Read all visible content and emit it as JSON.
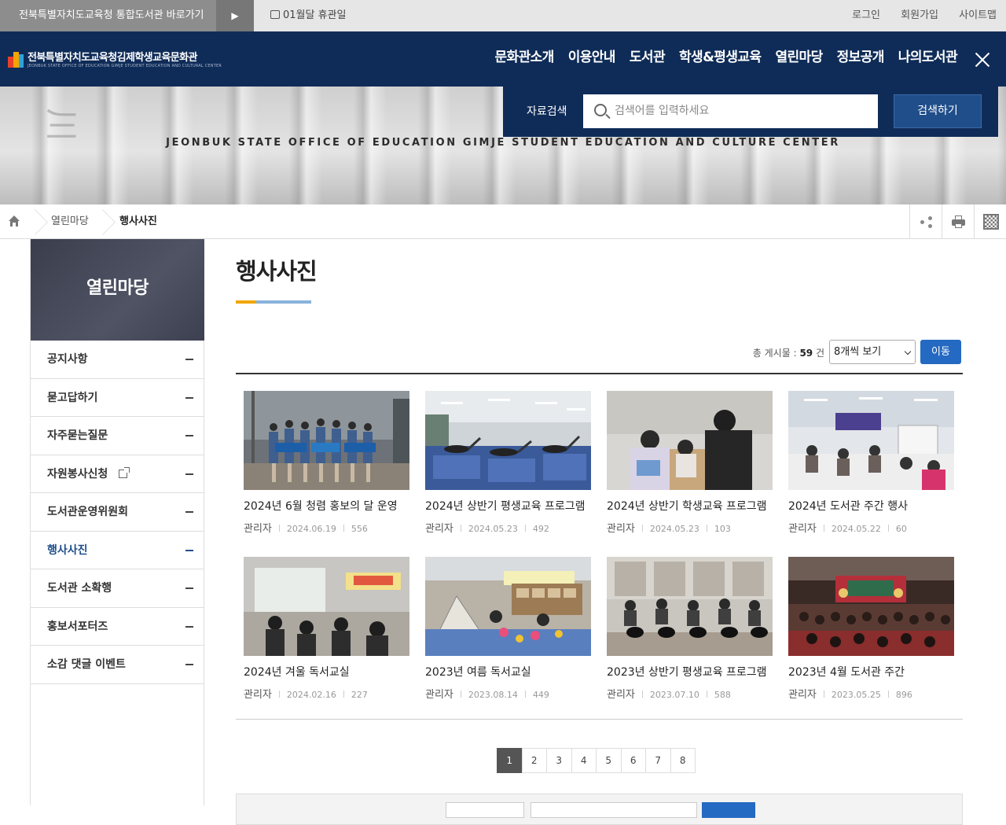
{
  "topbar": {
    "portal_link": "전북특별자치도교육청 통합도서관 바로가기",
    "closed_day": "01월달 휴관일",
    "util": [
      "로그인",
      "회원가입",
      "사이트맵"
    ]
  },
  "header": {
    "site_name": "전북특별자치도교육청김제학생교육문화관",
    "site_name_en": "JEONBUK STATE OFFICE OF EDUCATION GIMJE STUDENT EDUCATION AND CULTURAL CENTER",
    "nav": [
      "문화관소개",
      "이용안내",
      "도서관",
      "학생&평생교육",
      "열린마당",
      "정보공개",
      "나의도서관"
    ]
  },
  "hero": {
    "slogan": "JEONBUK STATE OFFICE OF EDUCATION GIMJE STUDENT EDUCATION AND CULTURE CENTER",
    "search_label": "자료검색",
    "search_placeholder": "검색어를 입력하세요",
    "search_button": "검색하기"
  },
  "breadcrumb": [
    "열린마당",
    "행사사진"
  ],
  "sidebar": {
    "title": "열린마당",
    "items": [
      {
        "label": "공지사항"
      },
      {
        "label": "묻고답하기"
      },
      {
        "label": "자주묻는질문"
      },
      {
        "label": "자원봉사신청"
      },
      {
        "label": "도서관운영위원회"
      },
      {
        "label": "행사사진"
      },
      {
        "label": "도서관 소확행"
      },
      {
        "label": "홍보서포터즈"
      },
      {
        "label": "소감 댓글 이벤트"
      }
    ],
    "active_index": 5
  },
  "page": {
    "title": "행사사진",
    "total_label": "총 게시물 : ",
    "total_count": "59",
    "total_unit": " 건",
    "per_page_option": "8개씩 보기",
    "go_button": "이동"
  },
  "gallery": [
    {
      "title": "2024년 6월 청렴 홍보의 달 운영",
      "author": "관리자",
      "date": "2024.06.19",
      "views": "556"
    },
    {
      "title": "2024년 상반기 평생교육 프로그램",
      "author": "관리자",
      "date": "2024.05.23",
      "views": "492"
    },
    {
      "title": "2024년 상반기 학생교육 프로그램",
      "author": "관리자",
      "date": "2024.05.23",
      "views": "103"
    },
    {
      "title": "2024년 도서관 주간 행사",
      "author": "관리자",
      "date": "2024.05.22",
      "views": "60"
    },
    {
      "title": "2024년 겨울 독서교실",
      "author": "관리자",
      "date": "2024.02.16",
      "views": "227"
    },
    {
      "title": "2023년 여름 독서교실",
      "author": "관리자",
      "date": "2023.08.14",
      "views": "449"
    },
    {
      "title": "2023년 상반기 평생교육 프로그램",
      "author": "관리자",
      "date": "2023.07.10",
      "views": "588"
    },
    {
      "title": "2023년 4월 도서관 주간",
      "author": "관리자",
      "date": "2023.05.25",
      "views": "896"
    }
  ],
  "pagination": {
    "pages": [
      "1",
      "2",
      "3",
      "4",
      "5",
      "6",
      "7",
      "8"
    ],
    "current": "1"
  },
  "colors": {
    "header_bg": "#0f2c58",
    "accent_blue": "#2469c2",
    "title_bar_yellow": "#f2a600",
    "title_bar_blue": "#88b3db"
  }
}
